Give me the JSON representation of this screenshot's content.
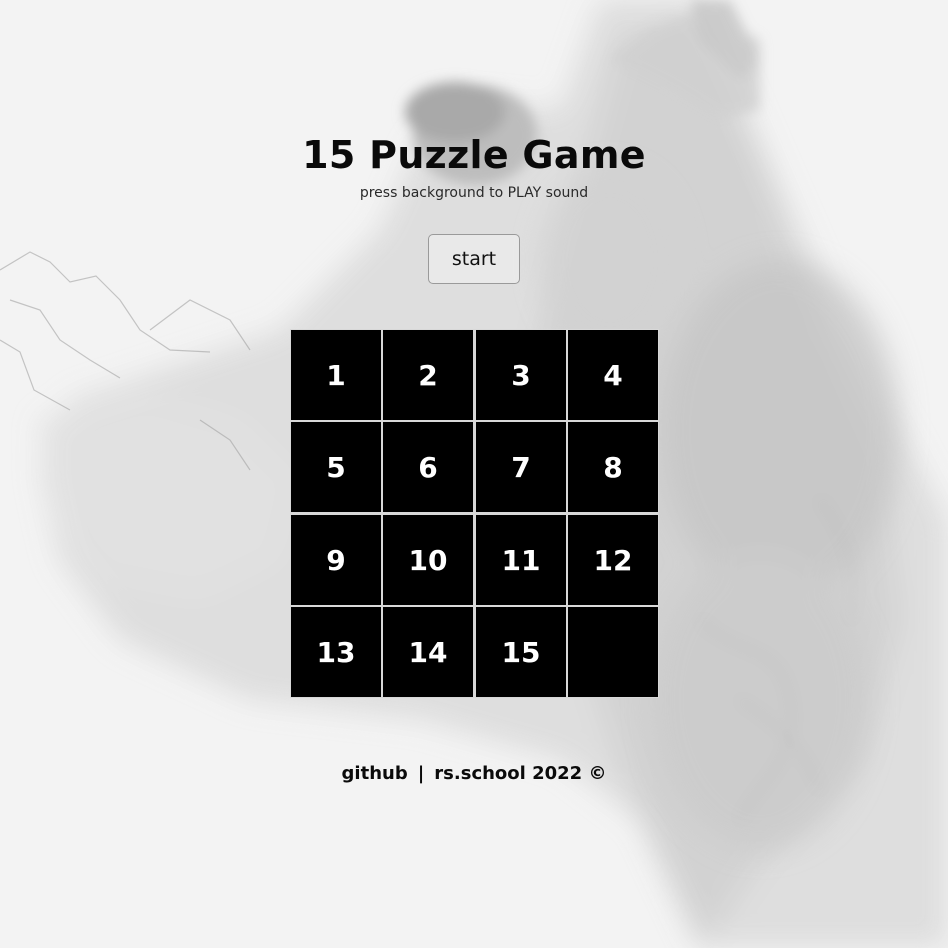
{
  "header": {
    "title": "15 Puzzle Game",
    "subtitle": "press background to PLAY sound"
  },
  "controls": {
    "start_label": "start"
  },
  "board": {
    "size": 4,
    "tiles": [
      "1",
      "2",
      "3",
      "4",
      "5",
      "6",
      "7",
      "8",
      "9",
      "10",
      "11",
      "12",
      "13",
      "14",
      "15",
      ""
    ]
  },
  "footer": {
    "github_label": "github",
    "separator": "|",
    "school_label": "rs.school 2022 ©"
  },
  "colors": {
    "tile_background": "#000000",
    "tile_text": "#ffffff",
    "page_background": "#f2f2f2"
  }
}
